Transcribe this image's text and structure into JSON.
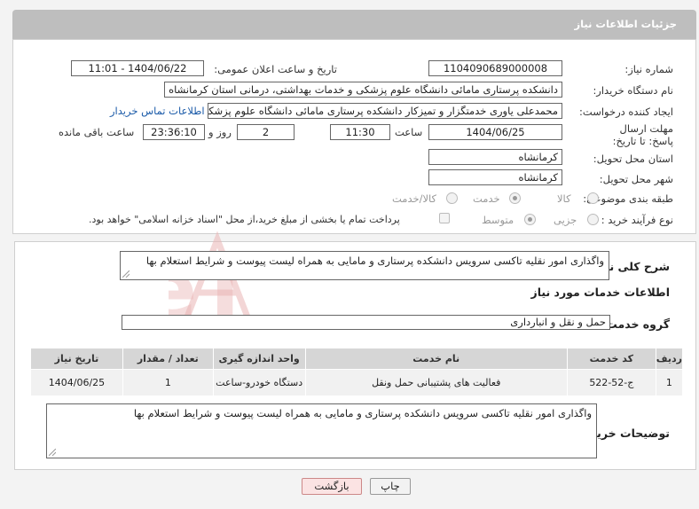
{
  "header": {
    "title": "جزئیات اطلاعات نیاز"
  },
  "fields": {
    "need_number": {
      "label": "شماره نیاز:",
      "value": "1104090689000008"
    },
    "announce_datetime": {
      "label": "تاریخ و ساعت اعلان عمومی:",
      "value": "1404/06/22 - 11:01"
    },
    "buyer_org": {
      "label": "نام دستگاه خریدار:",
      "value": "دانشکده پرستاری مامائی دانشگاه علوم پزشکی و خدمات بهداشتی، درمانی استان کرمانشاه"
    },
    "requester": {
      "label": "ایجاد کننده درخواست:",
      "value": "محمدعلی یاوری خدمتگزار و تمیزکار دانشکده پرستاری مامائی دانشگاه علوم پزشکی"
    },
    "buyer_contact_link": "اطلاعات تماس خریدار",
    "deadline": {
      "label": "مهلت ارسال پاسخ: تا تاریخ:",
      "date": "1404/06/25",
      "time_label": "ساعت",
      "time": "11:30",
      "days": "2",
      "days_label": "روز و",
      "remaining": "23:36:10",
      "remaining_label": "ساعت باقی مانده"
    },
    "province": {
      "label": "استان محل تحویل:",
      "value": "کرمانشاه"
    },
    "city": {
      "label": "شهر محل تحویل:",
      "value": "کرمانشاه"
    },
    "category": {
      "label": "طبقه بندی موضوعی:",
      "options": [
        "کالا",
        "خدمت",
        "کالا/خدمت"
      ],
      "selected": "خدمت"
    },
    "process_type": {
      "label": "نوع فرآیند خرید :",
      "options": [
        "جزیی",
        "متوسط"
      ],
      "selected": "متوسط",
      "payment_note": "پرداخت تمام یا بخشی از مبلغ خرید،از محل \"اسناد خزانه اسلامی\" خواهد بود."
    }
  },
  "summary": {
    "label": "شرح کلی نیاز:",
    "value": "واگذاری امور نقلیه تاکسی سرویس دانشکده پرستاری و مامایی به همراه لیست پیوست و شرایط استعلام بها"
  },
  "services_section": {
    "title": "اطلاعات خدمات مورد نیاز",
    "group_label": "گروه خدمت:",
    "group_value": "حمل و نقل و انبارداری"
  },
  "table": {
    "headers": [
      "ردیف",
      "کد خدمت",
      "نام خدمت",
      "واحد اندازه گیری",
      "تعداد / مقدار",
      "تاریخ نیاز"
    ],
    "rows": [
      [
        "1",
        "ج-52-522",
        "فعالیت های پشتیبانی حمل ونقل",
        "دستگاه خودرو-ساعت",
        "1",
        "1404/06/25"
      ]
    ]
  },
  "buyer_notes": {
    "label": "توضیحات خریدار:",
    "value": "واگذاری امور نقلیه تاکسی سرویس دانشکده پرستاری و مامایی به همراه لیست پیوست و شرایط استعلام بها"
  },
  "buttons": {
    "print": "چاپ",
    "back": "بازگشت"
  },
  "watermark": {
    "text": "AriaTender.neT"
  },
  "colors": {
    "header_bg": "#bebebe",
    "link": "#1a5aa8",
    "back_button": "#fbe3e3",
    "watermark": "#e9b4b4"
  }
}
